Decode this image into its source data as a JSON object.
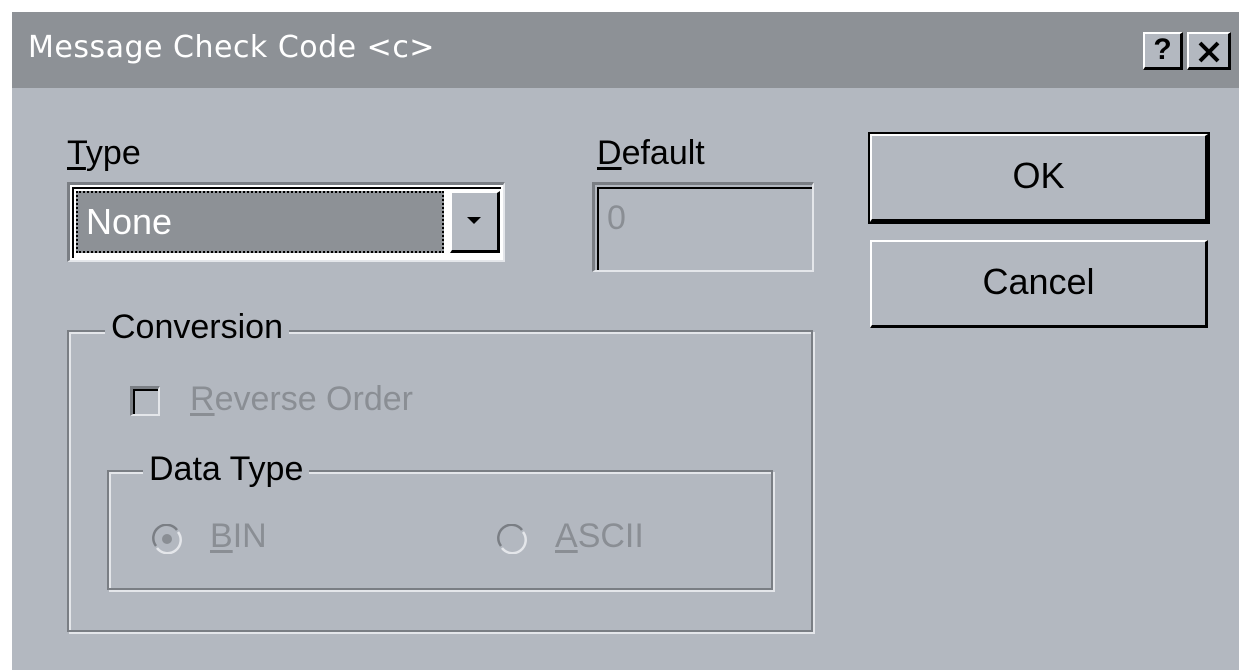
{
  "window": {
    "title": "Message Check Code <c>",
    "help_label": "?",
    "close_icon": "close-icon"
  },
  "type_field": {
    "label_mnemonic": "T",
    "label_rest": "ype",
    "value": "None",
    "dropdown_icon": "chevron-down-icon"
  },
  "default_field": {
    "label_mnemonic": "D",
    "label_rest": "efault",
    "value": "0",
    "enabled": false
  },
  "buttons": {
    "ok": "OK",
    "cancel": "Cancel"
  },
  "conversion": {
    "legend": "Conversion",
    "reverse_order": {
      "label_mnemonic": "R",
      "label_rest": "everse Order",
      "checked": false,
      "enabled": false
    },
    "data_type": {
      "legend": "Data Type",
      "options": [
        {
          "mnemonic": "B",
          "rest": "IN",
          "selected": true
        },
        {
          "mnemonic": "A",
          "rest": "SCII",
          "selected": false
        }
      ]
    }
  },
  "colors": {
    "face": "#b3b8c0",
    "title_bar": "#8d9196",
    "disabled_text": "#8a8e94"
  }
}
